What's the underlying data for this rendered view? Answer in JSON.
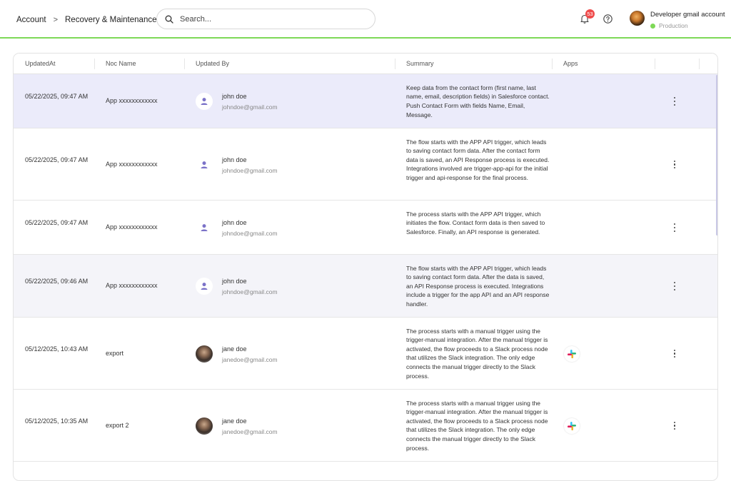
{
  "header": {
    "breadcrumb": [
      "Account",
      "Recovery & Maintenance"
    ],
    "breadcrumb_separator": ">",
    "search_placeholder": "Search...",
    "notification_count": "53",
    "user_name": "Developer gmail account",
    "environment": "Production"
  },
  "colors": {
    "accent_green": "#7ed957",
    "highlight_row": "#ebebfa",
    "alt_row": "#f4f4f9",
    "badge_red": "#ef4b4b",
    "user_icon": "#7b72c8"
  },
  "table": {
    "columns": [
      "UpdatedAt",
      "Noc Name",
      "Updated By",
      "Summary",
      "Apps"
    ],
    "rows": [
      {
        "updated_at": "05/22/2025, 09:47 AM",
        "noc_name": "App xxxxxxxxxxxx",
        "user_name": "john doe",
        "user_email": "johndoe@gmail.com",
        "avatar": "user-icon",
        "summary": "Keep data from the contact form (first name, last name, email, description fields) in Salesforce contact. Push Contact Form with fields Name, Email, Message.",
        "apps": []
      },
      {
        "updated_at": "05/22/2025, 09:47 AM",
        "noc_name": "App xxxxxxxxxxxx",
        "user_name": "john doe",
        "user_email": "johndoe@gmail.com",
        "avatar": "user-icon",
        "summary": "The flow starts with the APP API trigger, which leads to saving contact form data. After the contact form data is saved, an API Response process is executed. Integrations involved are trigger-app-api for the initial trigger and api-response for the final process.",
        "apps": []
      },
      {
        "updated_at": "05/22/2025, 09:47 AM",
        "noc_name": "App xxxxxxxxxxxx",
        "user_name": "john doe",
        "user_email": "johndoe@gmail.com",
        "avatar": "user-icon",
        "summary": "The process starts with the APP API trigger, which initiates the flow. Contact form data is then saved to Salesforce. Finally, an API response is generated.",
        "apps": []
      },
      {
        "updated_at": "05/22/2025, 09:46 AM",
        "noc_name": "App xxxxxxxxxxxx",
        "user_name": "john doe",
        "user_email": "johndoe@gmail.com",
        "avatar": "user-icon",
        "summary": "The flow starts with the APP API trigger, which leads to saving contact form data. After the data is saved, an API Response process is executed. Integrations include a trigger for the app API and an API response handler.",
        "apps": []
      },
      {
        "updated_at": "05/12/2025, 10:43 AM",
        "noc_name": "export",
        "user_name": "jane doe",
        "user_email": "janedoe@gmail.com",
        "avatar": "photo",
        "summary": "The process starts with a manual trigger using the trigger-manual integration. After the manual trigger is activated, the flow proceeds to a Slack process node that utilizes the Slack integration. The only edge connects the manual trigger directly to the Slack process.",
        "apps": [
          "slack-icon"
        ]
      },
      {
        "updated_at": "05/12/2025, 10:35 AM",
        "noc_name": "export 2",
        "user_name": "jane doe",
        "user_email": "janedoe@gmail.com",
        "avatar": "photo",
        "summary": "The process starts with a manual trigger using the trigger-manual integration. After the manual trigger is activated, the flow proceeds to a Slack process node that utilizes the Slack integration. The only edge connects the manual trigger directly to the Slack process.",
        "apps": [
          "slack-icon"
        ]
      }
    ]
  }
}
